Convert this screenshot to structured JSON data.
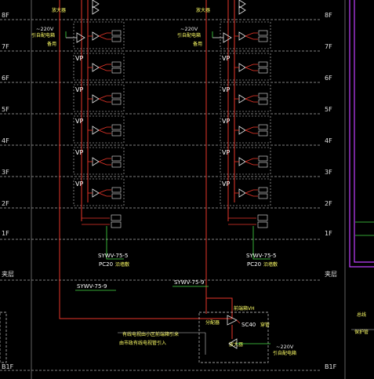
{
  "floors": [
    "8F",
    "7F",
    "6F",
    "5F",
    "4F",
    "3F",
    "2F",
    "1F",
    "夹层",
    "B1F"
  ],
  "vp_label": "VP",
  "left_riser": {
    "amp_label": "放大器",
    "power_label": "~220V",
    "power_note": "引自配电箱",
    "power_note2": "备用",
    "cable_label": "SYWV-75-5",
    "conduit_label": "PC20",
    "conduit_note": "沿墙敷"
  },
  "right_riser": {
    "amp_label": "放大器",
    "power_label": "~220V",
    "power_note": "引自配电箱",
    "power_note2": "备用",
    "cable_label": "SYWV-75-5",
    "conduit_label": "PC20",
    "conduit_note": "沿墙敷"
  },
  "trunk_left_label": "SYWV-75-9",
  "trunk_mid_label": "SYWV-75-9",
  "headend": {
    "title": "前端箱VH",
    "splitter_label": "分配器",
    "sc_label": "SC40",
    "sc_note": "穿管",
    "amp_label": "放大器",
    "power_label": "~220V",
    "power_note": "引自配电箱",
    "note_line1": "有线电视由小区前端箱引来",
    "note_line2": "由市政有线电视管引入"
  },
  "right_edge_note1": "总线",
  "right_edge_note2": "保护管"
}
